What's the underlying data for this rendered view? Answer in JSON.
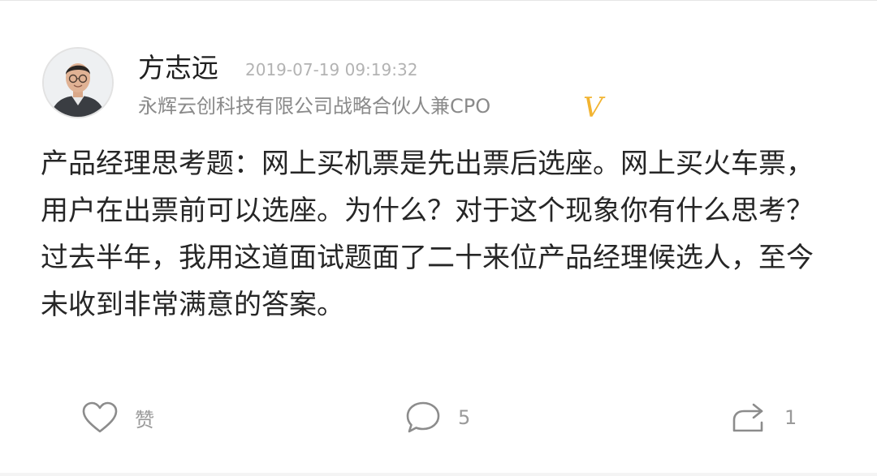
{
  "post": {
    "author": {
      "name": "方志远",
      "title": "永辉云创科技有限公司战略合伙人兼CPO",
      "verified_badge": "V",
      "avatar_icon": "person-portrait"
    },
    "timestamp": "2019-07-19 09:19:32",
    "body_paragraphs": [
      "产品经理思考题：网上买机票是先出票后选座。网上买火车票，用户在出票前可以选座。为什么？对于这个现象你有什么思考？",
      "过去半年，我用这道面试题面了二十来位产品经理候选人，至今未收到非常满意的答案。"
    ],
    "actions": {
      "like_label": "赞",
      "comment_count": "5",
      "share_count": "1"
    }
  },
  "colors": {
    "verified": "#f2b431",
    "meta_gray": "#b3b3b3",
    "icon_gray": "#8c8c8c"
  }
}
